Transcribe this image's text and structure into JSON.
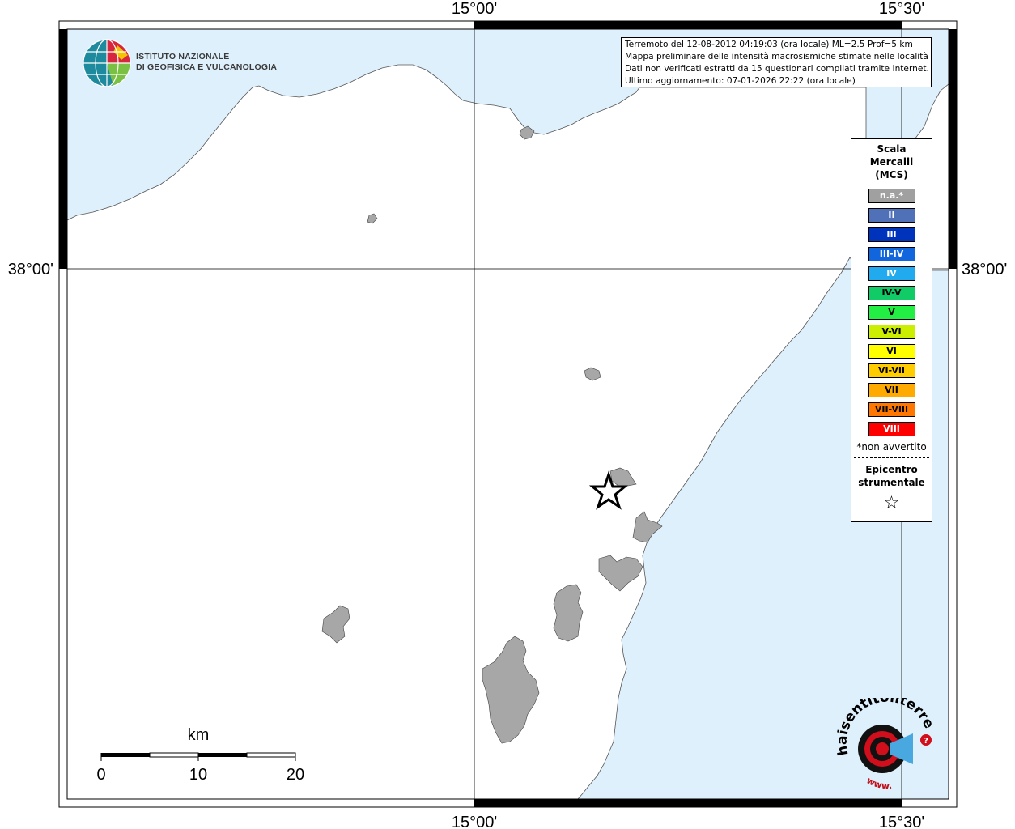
{
  "map": {
    "grid_labels": {
      "top_left_lon": "15°00'",
      "top_right_lon": "15°30'",
      "bottom_left_lon": "15°00'",
      "bottom_right_lon": "15°30'",
      "left_lat": "38°00'",
      "right_lat": "38°00'"
    },
    "colors": {
      "sea": "#dff0fd",
      "land": "#ffffff",
      "urban": "#a7a7a7",
      "frame": "#000000"
    }
  },
  "info": {
    "line1": "Terremoto del 12-08-2012 04:19:03 (ora locale) ML=2.5 Prof=5 km",
    "line2": "Mappa preliminare delle intensità macrosismiche stimate nelle località",
    "line3": "Dati non verificati estratti da 15 questionari compilati tramite Internet.",
    "line4": "Ultimo aggiornamento: 07-01-2026 22:22 (ora locale)"
  },
  "logo": {
    "line1": "ISTITUTO NAZIONALE",
    "line2": "DI GEOFISICA E VULCANOLOGIA",
    "site": "haisentitoilterremoto.it",
    "site_prefix": "www."
  },
  "legend": {
    "title1": "Scala",
    "title2": "Mercalli",
    "title3": "(MCS)",
    "items": [
      {
        "label": "n.a.*",
        "color": "#a0a0a0",
        "text_color": "#ffffff"
      },
      {
        "label": "II",
        "color": "#5070b8",
        "text_color": "#ffffff"
      },
      {
        "label": "III",
        "color": "#0033bb",
        "text_color": "#ffffff"
      },
      {
        "label": "III-IV",
        "color": "#1166dd",
        "text_color": "#ffffff"
      },
      {
        "label": "IV",
        "color": "#22aaee",
        "text_color": "#ffffff"
      },
      {
        "label": "IV-V",
        "color": "#11cc66",
        "text_color": "#000000"
      },
      {
        "label": "V",
        "color": "#22ee44",
        "text_color": "#000000"
      },
      {
        "label": "V-VI",
        "color": "#ccee00",
        "text_color": "#000000"
      },
      {
        "label": "VI",
        "color": "#ffff00",
        "text_color": "#000000"
      },
      {
        "label": "VI-VII",
        "color": "#ffcc00",
        "text_color": "#000000"
      },
      {
        "label": "VII",
        "color": "#ffaa00",
        "text_color": "#000000"
      },
      {
        "label": "VII-VIII",
        "color": "#ff7700",
        "text_color": "#000000"
      },
      {
        "label": "VIII",
        "color": "#ff0000",
        "text_color": "#ffffff"
      }
    ],
    "note": "*non avvertito",
    "epicenter1": "Epicentro",
    "epicenter2": "strumentale",
    "epicenter_symbol": "☆"
  },
  "scale_bar": {
    "unit": "km",
    "ticks": [
      "0",
      "10",
      "20"
    ]
  },
  "markers": {
    "epicenter_icon": "star-icon"
  }
}
